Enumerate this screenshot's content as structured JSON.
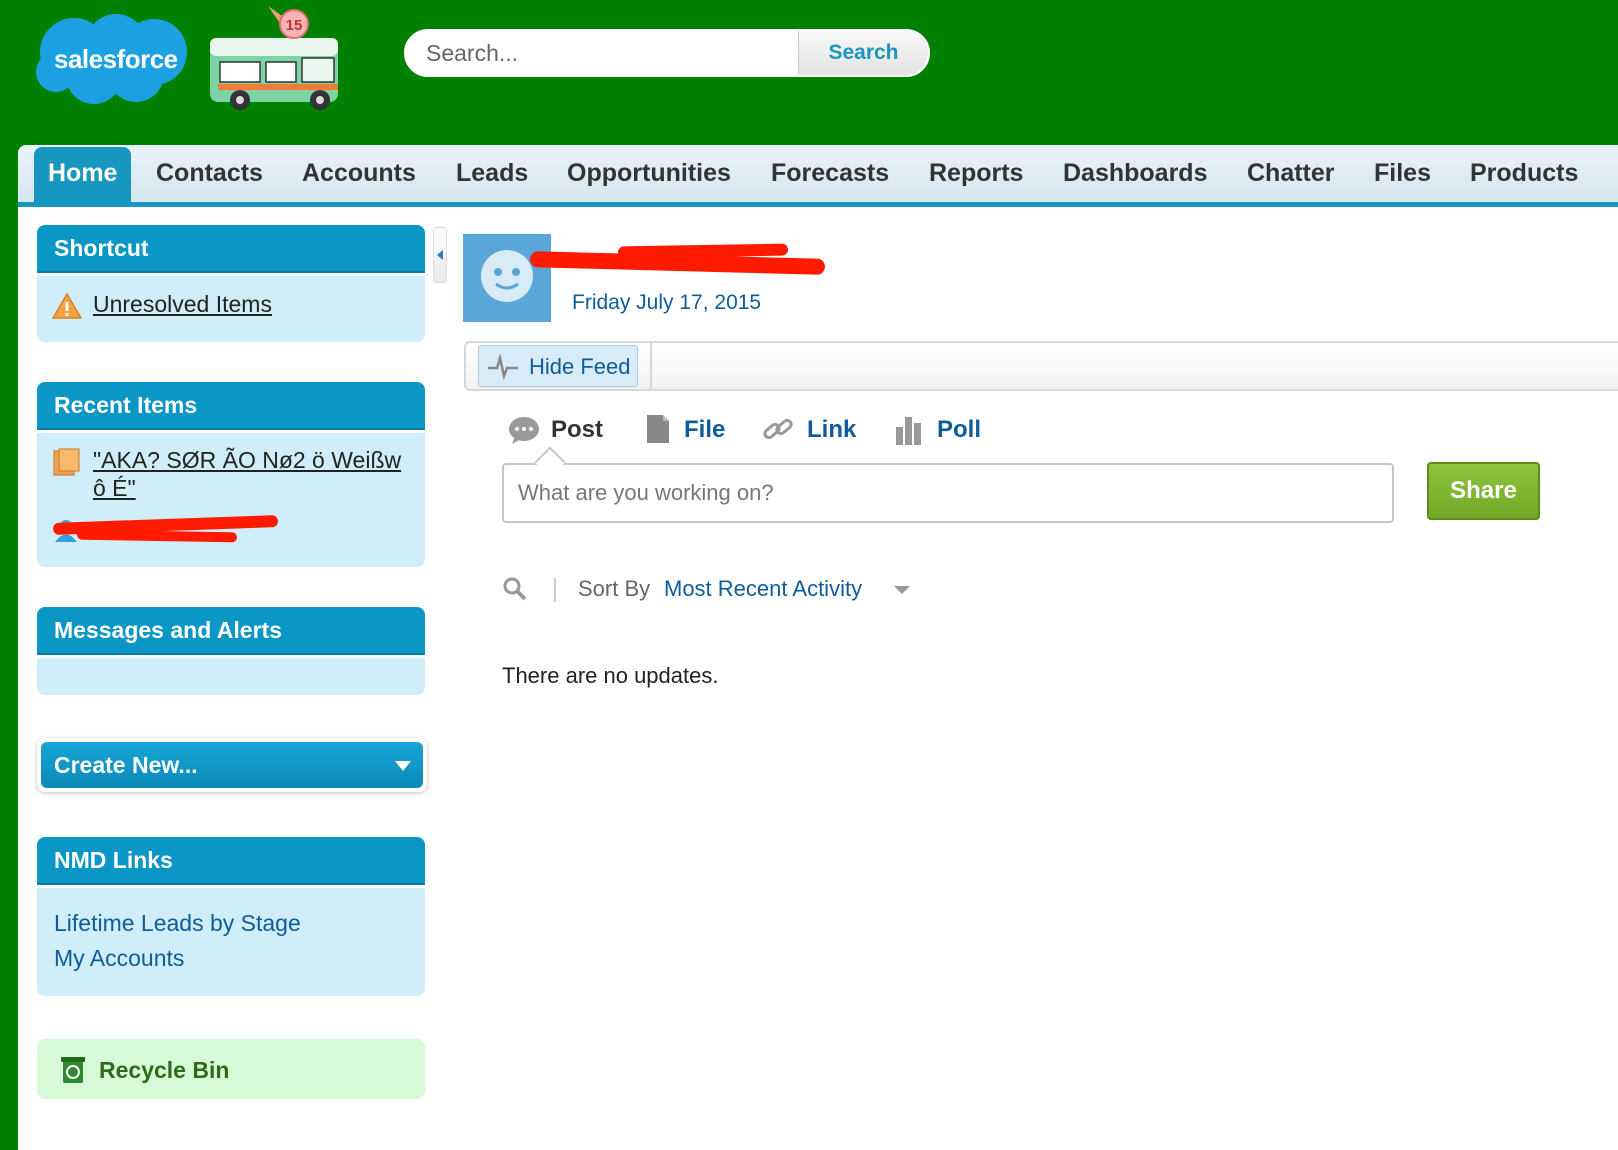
{
  "header": {
    "logo_text": "salesforce",
    "badge_number": "15",
    "search_placeholder": "Search...",
    "search_button": "Search"
  },
  "tabs": [
    {
      "label": "Home",
      "active": true
    },
    {
      "label": "Contacts"
    },
    {
      "label": "Accounts"
    },
    {
      "label": "Leads"
    },
    {
      "label": "Opportunities"
    },
    {
      "label": "Forecasts"
    },
    {
      "label": "Reports"
    },
    {
      "label": "Dashboards"
    },
    {
      "label": "Chatter"
    },
    {
      "label": "Files"
    },
    {
      "label": "Products"
    }
  ],
  "sidebar": {
    "shortcut": {
      "title": "Shortcut",
      "items": [
        "Unresolved Items"
      ]
    },
    "recent_items": {
      "title": "Recent Items",
      "items": [
        "\"AKA? SØR ÃO Nø2 ö Weißw",
        "ô É\""
      ]
    },
    "messages": {
      "title": "Messages and Alerts"
    },
    "create_new": {
      "label": "Create New..."
    },
    "nmd_links": {
      "title": "NMD Links",
      "items": [
        "Lifetime Leads by Stage",
        "My Accounts"
      ]
    },
    "recycle_bin": {
      "label": "Recycle Bin"
    }
  },
  "profile": {
    "date": "Friday July 17, 2015"
  },
  "feed": {
    "hide_feed": "Hide Feed",
    "publisher_tabs": [
      "Post",
      "File",
      "Link",
      "Poll"
    ],
    "input_placeholder": "What are you working on?",
    "share_button": "Share",
    "sort_label": "Sort By",
    "sort_value": "Most Recent Activity",
    "empty_message": "There are no updates."
  },
  "colors": {
    "header_bg": "#008000",
    "brand_blue": "#0a97c5",
    "sidebar_bg": "#cfeef9",
    "link_blue": "#0e5c9c",
    "share_green": "#7db633",
    "redaction": "#ff1a00"
  }
}
